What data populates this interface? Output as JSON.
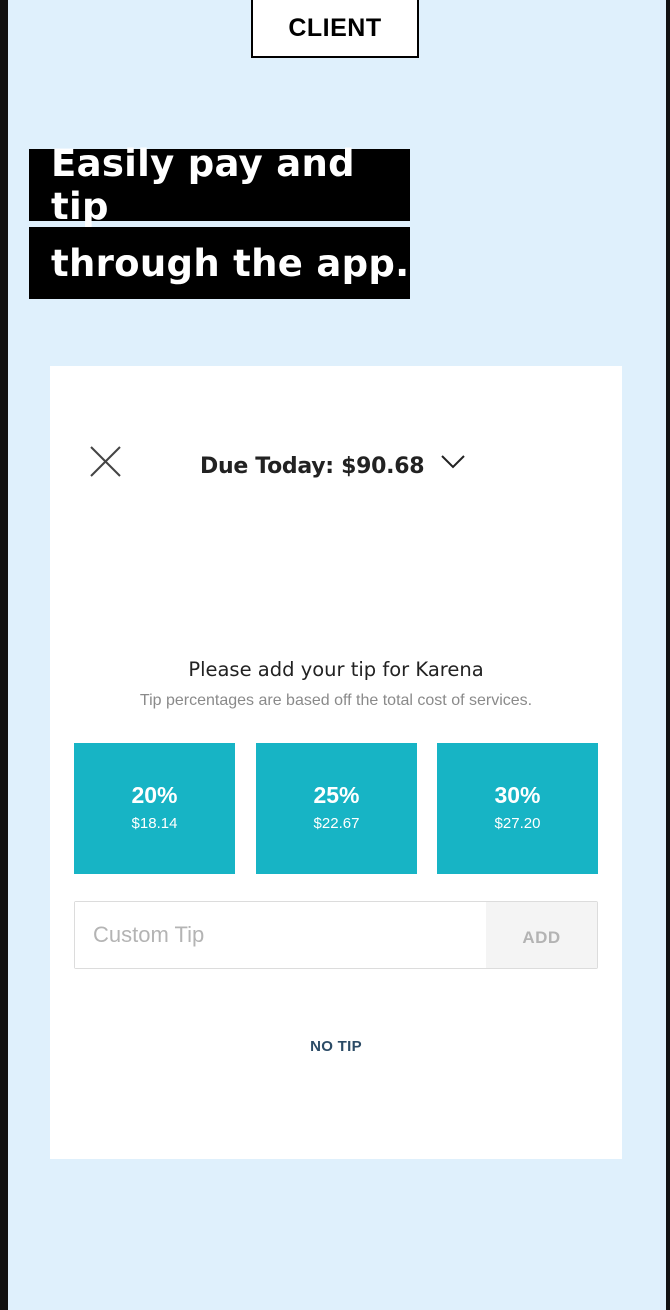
{
  "header": {
    "tag": "CLIENT"
  },
  "headline": {
    "line1": "Easily pay and tip",
    "line2": "through the app."
  },
  "modal": {
    "due_label": "Due Today: $90.68",
    "tip_title": "Please add your tip for Karena",
    "tip_subtitle": "Tip percentages are based off the total cost of services.",
    "tip_options": [
      {
        "percent": "20%",
        "amount": "$18.14"
      },
      {
        "percent": "25%",
        "amount": "$22.67"
      },
      {
        "percent": "30%",
        "amount": "$27.20"
      }
    ],
    "custom_tip": {
      "placeholder": "Custom Tip",
      "value": ""
    },
    "add_label": "ADD",
    "no_tip_label": "NO TIP"
  },
  "colors": {
    "background": "#dff0fc",
    "tip_button": "#17b4c5",
    "no_tip_text": "#2b4b66"
  },
  "icons": {
    "close": "close-icon",
    "chevron": "chevron-down-icon"
  }
}
